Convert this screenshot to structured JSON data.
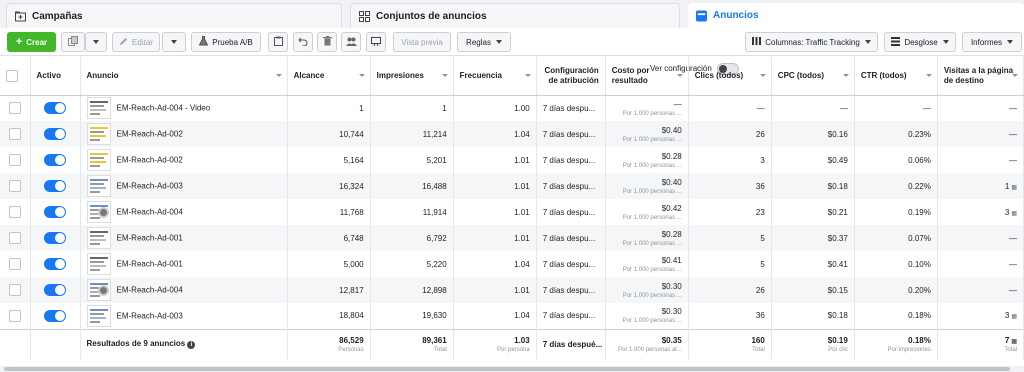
{
  "tabs": [
    {
      "label": "Campañas",
      "icon": "folder-icon"
    },
    {
      "label": "Conjuntos de anuncios",
      "icon": "grid-icon"
    },
    {
      "label": "Anuncios",
      "icon": "ad-icon"
    }
  ],
  "toolbar": {
    "create_label": "Crear",
    "edit_label": "Editar",
    "ab_test_label": "Prueba A/B",
    "preview_label": "Vista previa",
    "rules_label": "Reglas",
    "view_config_label": "Ver configuración",
    "columns_label": "Columnas: Traffic Tracking",
    "breakdown_label": "Desglose",
    "reports_label": "Informes"
  },
  "columns": [
    "Activo",
    "Anuncio",
    "Alcance",
    "Impresiones",
    "Frecuencia",
    "Configuración de atribución",
    "Costo por resultado",
    "Clics (todos)",
    "CPC (todos)",
    "CTR (todos)",
    "Visitas a la página de destino"
  ],
  "rows": [
    {
      "name": "EM-Reach-Ad-004 - Video",
      "thumb": "plain",
      "reach": "1",
      "impr": "1",
      "freq": "1.00",
      "attr": "7 días despu...",
      "cost": "—",
      "cost_sub": "Por 1.000 personas ...",
      "clicks": "—",
      "cpc": "—",
      "ctr": "—",
      "visits": "—"
    },
    {
      "name": "EM-Reach-Ad-002",
      "thumb": "y",
      "reach": "10,744",
      "impr": "11,214",
      "freq": "1.04",
      "attr": "7 días despu...",
      "cost": "$0.40",
      "cost_sub": "Por 1.000 personas ...",
      "clicks": "26",
      "cpc": "$0.16",
      "ctr": "0.23%",
      "visits": "—"
    },
    {
      "name": "EM-Reach-Ad-002",
      "thumb": "y",
      "reach": "5,164",
      "impr": "5,201",
      "freq": "1.01",
      "attr": "7 días despu...",
      "cost": "$0.28",
      "cost_sub": "Por 1.000 personas ...",
      "clicks": "3",
      "cpc": "$0.49",
      "ctr": "0.06%",
      "visits": "—"
    },
    {
      "name": "EM-Reach-Ad-003",
      "thumb": "b",
      "reach": "16,324",
      "impr": "16,488",
      "freq": "1.01",
      "attr": "7 días despu...",
      "cost": "$0.40",
      "cost_sub": "Por 1.000 personas ...",
      "clicks": "36",
      "cpc": "$0.18",
      "ctr": "0.22%",
      "visits": "1"
    },
    {
      "name": "EM-Reach-Ad-004",
      "thumb": "c",
      "reach": "11,768",
      "impr": "11,914",
      "freq": "1.01",
      "attr": "7 días despu...",
      "cost": "$0.42",
      "cost_sub": "Por 1.000 personas ...",
      "clicks": "23",
      "cpc": "$0.21",
      "ctr": "0.19%",
      "visits": "3"
    },
    {
      "name": "EM-Reach-Ad-001",
      "thumb": "plain",
      "reach": "6,748",
      "impr": "6,792",
      "freq": "1.01",
      "attr": "7 días despu...",
      "cost": "$0.28",
      "cost_sub": "Por 1.000 personas ...",
      "clicks": "5",
      "cpc": "$0.37",
      "ctr": "0.07%",
      "visits": "—"
    },
    {
      "name": "EM-Reach-Ad-001",
      "thumb": "plain",
      "reach": "5,000",
      "impr": "5,220",
      "freq": "1.04",
      "attr": "7 días despu...",
      "cost": "$0.41",
      "cost_sub": "Por 1.000 personas ...",
      "clicks": "5",
      "cpc": "$0.41",
      "ctr": "0.10%",
      "visits": "—"
    },
    {
      "name": "EM-Reach-Ad-004",
      "thumb": "c",
      "reach": "12,817",
      "impr": "12,898",
      "freq": "1.01",
      "attr": "7 días despu...",
      "cost": "$0.30",
      "cost_sub": "Por 1.000 personas ...",
      "clicks": "26",
      "cpc": "$0.15",
      "ctr": "0.20%",
      "visits": "—"
    },
    {
      "name": "EM-Reach-Ad-003",
      "thumb": "b",
      "reach": "18,804",
      "impr": "19,630",
      "freq": "1.04",
      "attr": "7 días despu...",
      "cost": "$0.30",
      "cost_sub": "Por 1.000 personas ...",
      "clicks": "36",
      "cpc": "$0.18",
      "ctr": "0.18%",
      "visits": "3"
    }
  ],
  "summary": {
    "label": "Resultados de 9 anuncios",
    "reach": "86,529",
    "reach_sub": "Personas",
    "impr": "89,361",
    "impr_sub": "Total",
    "freq": "1.03",
    "freq_sub": "Por persona",
    "attr": "7 días despué...",
    "cost": "$0.35",
    "cost_sub": "Por 1.000 personas al...",
    "clicks": "160",
    "clicks_sub": "Total",
    "cpc": "$0.19",
    "cpc_sub": "Por clic",
    "ctr": "0.18%",
    "ctr_sub": "Por impresiones",
    "visits": "7",
    "visits_sub": "Total"
  },
  "colors": {
    "accent": "#1877f2",
    "create": "#42b72a"
  }
}
